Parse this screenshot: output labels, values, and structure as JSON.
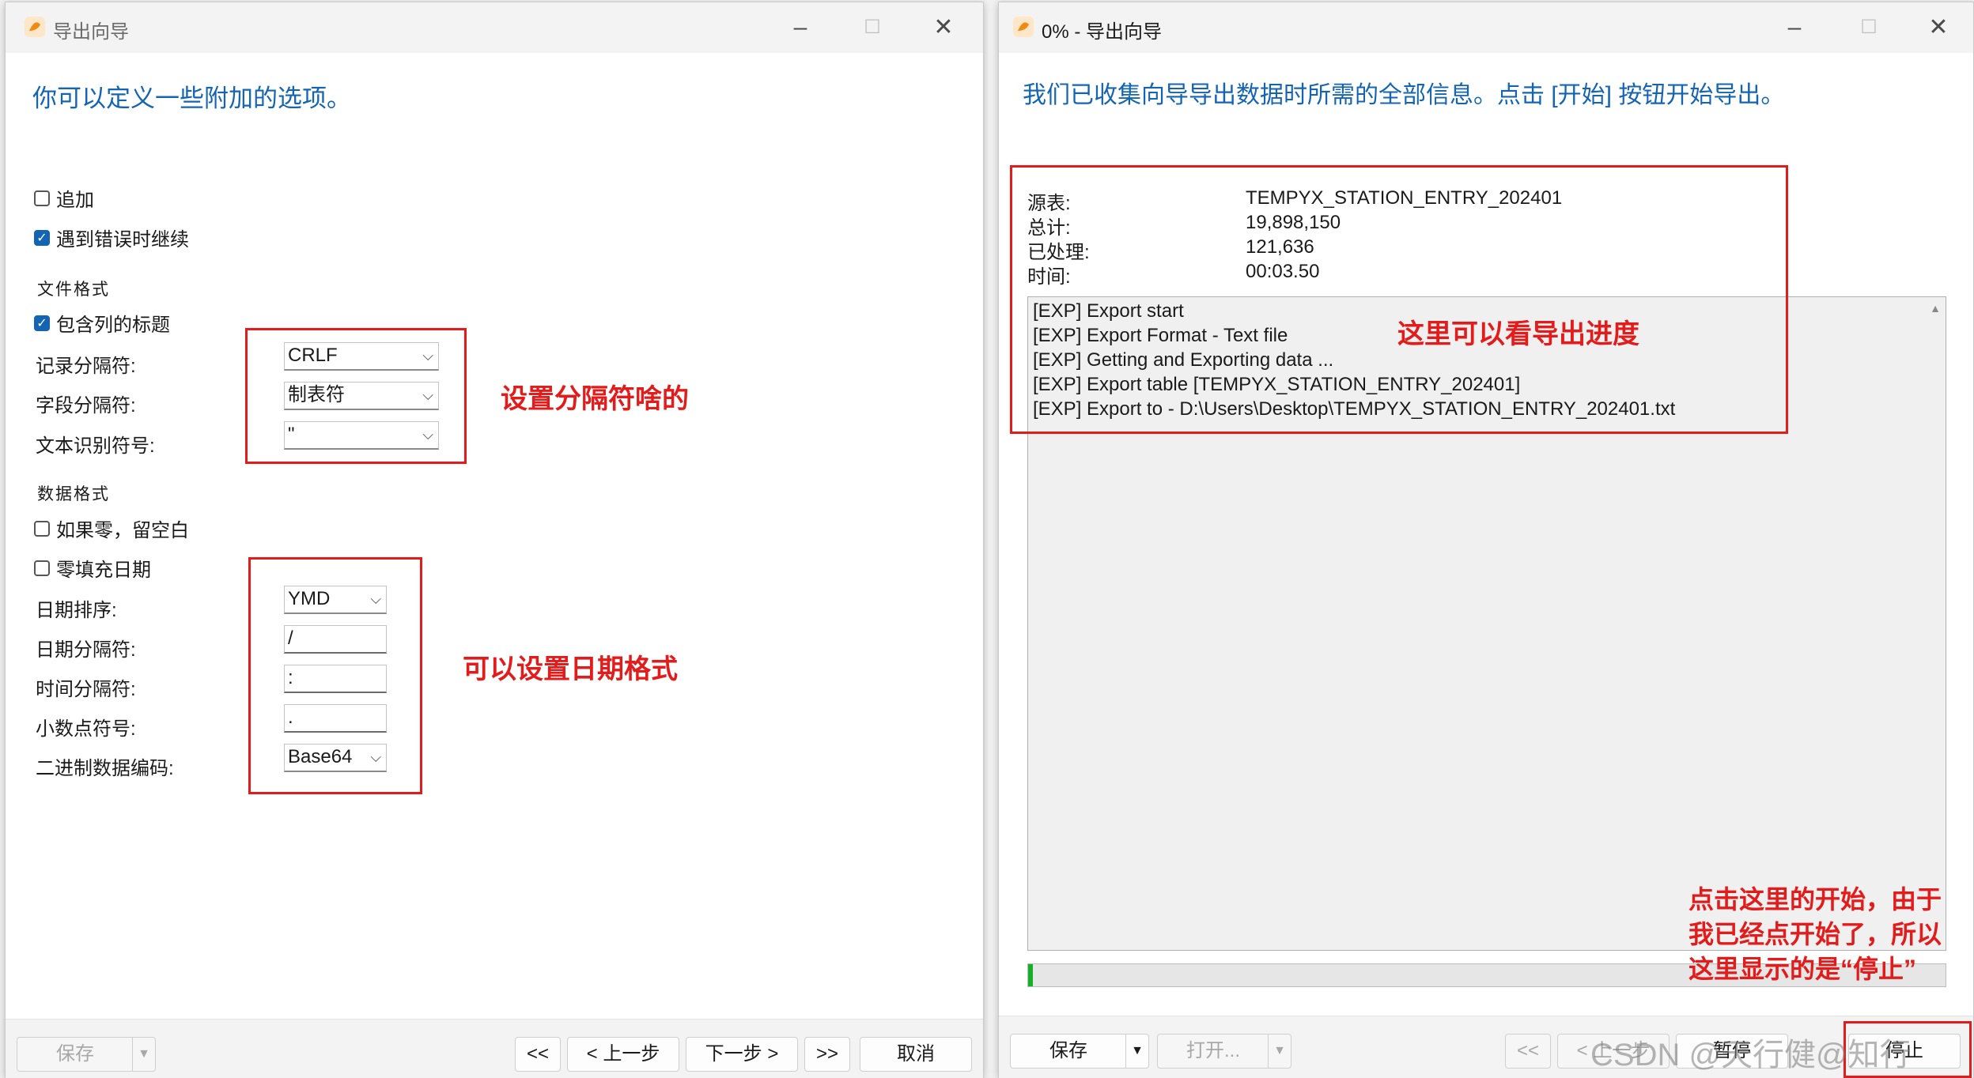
{
  "left": {
    "title": "导出向导",
    "heading": "你可以定义一些附加的选项。",
    "append_label": "追加",
    "continue_on_error_label": "遇到错误时继续",
    "file_format_title": "文件格式",
    "include_headers_label": "包含列的标题",
    "record_sep_label": "记录分隔符:",
    "record_sep_value": "CRLF",
    "field_sep_label": "字段分隔符:",
    "field_sep_value": "制表符",
    "text_qualifier_label": "文本识别符号:",
    "text_qualifier_value": "\"",
    "data_format_title": "数据格式",
    "blank_if_zero_label": "如果零，留空白",
    "zero_pad_date_label": "零填充日期",
    "date_order_label": "日期排序:",
    "date_order_value": "YMD",
    "date_sep_label": "日期分隔符:",
    "date_sep_value": "/",
    "time_sep_label": "时间分隔符:",
    "time_sep_value": ":",
    "decimal_label": "小数点符号:",
    "decimal_value": ".",
    "binary_label": "二进制数据编码:",
    "binary_value": "Base64",
    "annotation_sep": "设置分隔符啥的",
    "annotation_date": "可以设置日期格式",
    "save": "保存",
    "first": "<<",
    "prev": "< 上一步",
    "next": "下一步 >",
    "last": ">>",
    "cancel": "取消"
  },
  "right": {
    "title": "0% - 导出向导",
    "heading": "我们已收集向导导出数据时所需的全部信息。点击 [开始] 按钮开始导出。",
    "source_label": "源表:",
    "source_value": "TEMPYX_STATION_ENTRY_202401",
    "total_label": "总计:",
    "total_value": "19,898,150",
    "processed_label": "已处理:",
    "processed_value": "121,636",
    "time_label": "时间:",
    "time_value": "00:03.50",
    "log": [
      "[EXP] Export start",
      "[EXP] Export Format - Text file",
      "[EXP] Getting and Exporting data ...",
      "[EXP] Export table [TEMPYX_STATION_ENTRY_202401]",
      "[EXP] Export to - D:\\Users\\Desktop\\TEMPYX_STATION_ENTRY_202401.txt"
    ],
    "progress_percent": 0,
    "annotation_progress": "这里可以看导出进度",
    "annotation_stop_1": "点击这里的开始，由于",
    "annotation_stop_2": "我已经点开始了，所以",
    "annotation_stop_3": "这里显示的是“停止”",
    "save": "保存",
    "open": "打开...",
    "first": "<<",
    "prev": "< 上一步",
    "pause": "暂停",
    "stop": "停止",
    "watermark": "CSDN @天行健@知行"
  }
}
